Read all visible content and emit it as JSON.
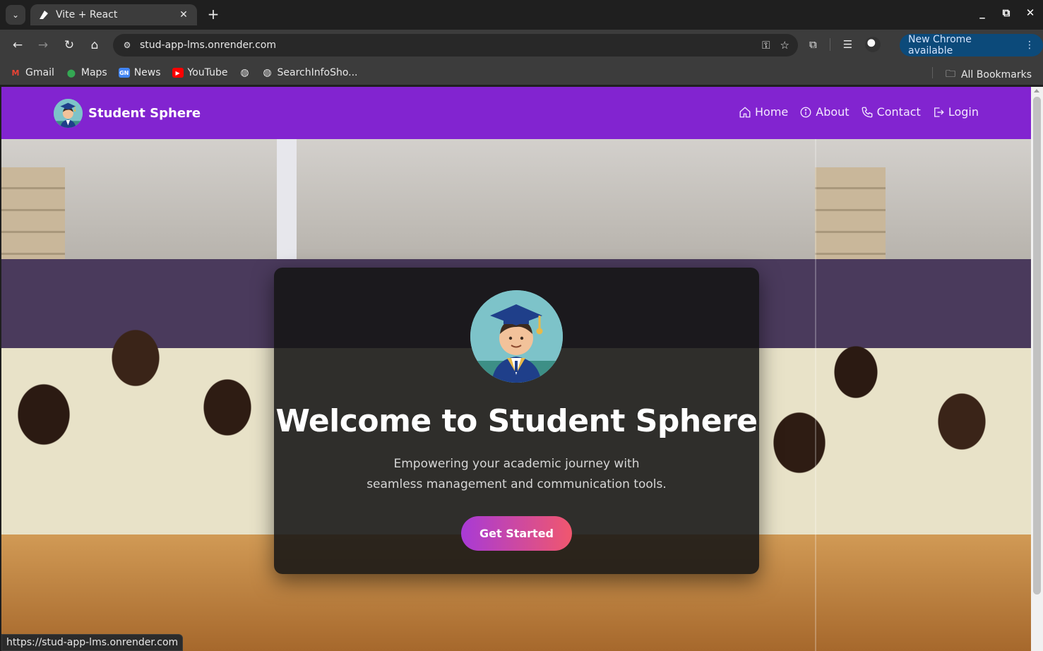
{
  "browser": {
    "tab": {
      "title": "Vite + React",
      "favicon": "vite-react-icon",
      "close_glyph": "✕"
    },
    "new_tab_glyph": "+",
    "window_controls": [
      "_",
      "⧉",
      "✕"
    ],
    "omnibox": {
      "url": "stud-app-lms.onrender.com"
    },
    "update_button": {
      "label": "New Chrome available"
    },
    "bookmarks": [
      {
        "label": "Gmail",
        "icon": "gmail-icon"
      },
      {
        "label": "Maps",
        "icon": "maps-icon"
      },
      {
        "label": "News",
        "icon": "news-icon"
      },
      {
        "label": "YouTube",
        "icon": "youtube-icon"
      },
      {
        "label": "",
        "icon": "globe-icon"
      },
      {
        "label": "SearchInfoSho...",
        "icon": "globe-icon"
      }
    ],
    "all_bookmarks": "All Bookmarks",
    "status_url": "https://stud-app-lms.onrender.com"
  },
  "site": {
    "brand": "Student Sphere",
    "nav": [
      {
        "label": "Home",
        "icon": "home-icon"
      },
      {
        "label": "About",
        "icon": "info-icon"
      },
      {
        "label": "Contact",
        "icon": "phone-icon"
      },
      {
        "label": "Login",
        "icon": "login-icon"
      }
    ],
    "hero": {
      "title": "Welcome to Student Sphere",
      "subtitle": "Empowering your academic journey with seamless management and communication tools.",
      "cta": "Get Started"
    },
    "colors": {
      "nav_bg": "#8224d0",
      "cta_start": "#a83ad6",
      "cta_end": "#f0576e"
    }
  }
}
